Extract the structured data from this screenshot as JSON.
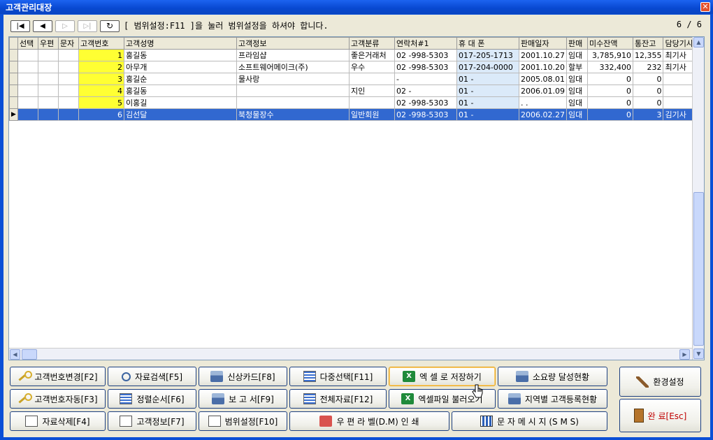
{
  "window": {
    "title": "고객관리대장",
    "close_glyph": "✕"
  },
  "nav": {
    "first": "|◀",
    "prev": "◀",
    "next": "▷",
    "last": "▷|",
    "refresh": "↻",
    "range_hint": "[ 범위설정:F11 ]을 눌러 범위설정을 하셔야 합니다.",
    "page_info": "6 / 6"
  },
  "table": {
    "columns": [
      "선택",
      "우편",
      "문자",
      "고객번호",
      "고객성명",
      "고객정보",
      "고객분류",
      "연락처#1",
      "휴 대 폰",
      "판매일자",
      "판매",
      "미수잔액",
      "통잔고",
      "담당기사"
    ],
    "rows": [
      {
        "id": "1",
        "name": "홍길동",
        "info": "프라임샵",
        "cls": "좋은거래처",
        "tel": "02  -998-5303",
        "mobile": "017-205-1713",
        "date": "2001.10.27",
        "sale": "임대",
        "due": "3,785,910",
        "bal": "12,355",
        "staff": "최기사"
      },
      {
        "id": "2",
        "name": "아무개",
        "info": "소프트웨어메이크(주)",
        "cls": "우수",
        "tel": "02  -998-5303",
        "mobile": "017-204-0000",
        "date": "2001.10.20",
        "sale": "할부",
        "due": "332,400",
        "bal": "232",
        "staff": "최기사"
      },
      {
        "id": "3",
        "name": "홍길순",
        "info": "물사랑",
        "cls": "",
        "tel": "      -",
        "mobile": "01 -",
        "date": "2005.08.01",
        "sale": "임대",
        "due": "0",
        "bal": "0",
        "staff": ""
      },
      {
        "id": "4",
        "name": "홍길동",
        "info": "",
        "cls": "지인",
        "tel": "02  -",
        "mobile": "01 -",
        "date": "2006.01.09",
        "sale": "임대",
        "due": "0",
        "bal": "0",
        "staff": ""
      },
      {
        "id": "5",
        "name": "이홍길",
        "info": "",
        "cls": "",
        "tel": "02  -998-5303",
        "mobile": "01 -",
        "date": "  .   .",
        "sale": "임대",
        "due": "0",
        "bal": "0",
        "staff": ""
      },
      {
        "id": "6",
        "name": "김선달",
        "info": "북청물장수",
        "cls": "일반회원",
        "tel": "02  -998-5303",
        "mobile": "01 -",
        "date": "2006.02.27",
        "sale": "임대",
        "due": "0",
        "bal": "3",
        "staff": "김기사"
      }
    ],
    "selected_row": 6,
    "row_marker": "▶"
  },
  "buttons": {
    "b1": "고객번호변경[F2]",
    "b2": "자료검색[F5]",
    "b3": "신상카드[F8]",
    "b4": "다중선택[F11]",
    "b5": "엑 셀 로 저장하기",
    "b6": "소요량 달성현황",
    "b7": "환경설정",
    "b8": "고객번호자동[F3]",
    "b9": "정렬순서[F6]",
    "b10": "보 고 서[F9]",
    "b11": "전체자료[F12]",
    "b12": "엑셀파일 불러오기",
    "b13": "지역별 고객등록현황",
    "b14": "완 료[Esc]",
    "b15": "자료삭제[F4]",
    "b16": "고객정보[F7]",
    "b17": "범위설정[F10]",
    "b18": "우 편 라 벨(D.M) 인 쇄",
    "b19": "문 자 메 시 지 (S M S)",
    "excel_glyph": "X"
  },
  "colors": {
    "title_bar": "#0a4fd6",
    "selected_row": "#3168d0",
    "id_cell": "#ffff33",
    "mobile_cell": "#dbeaf9",
    "exit_text": "#c00000"
  }
}
